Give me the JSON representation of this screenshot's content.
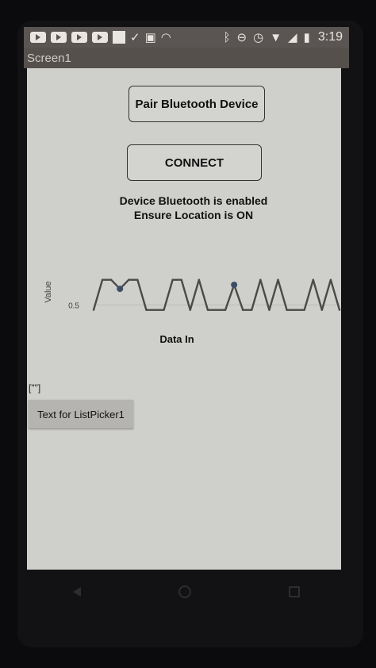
{
  "status_bar": {
    "time": "3:19",
    "icons": [
      "youtube-icon",
      "youtube-icon",
      "youtube-icon",
      "youtube-icon",
      "image-icon",
      "check-icon",
      "photo-icon",
      "cloud-icon",
      "bluetooth-icon",
      "do-not-disturb-icon",
      "alarm-icon",
      "wifi-icon",
      "signal-icon",
      "battery-icon"
    ]
  },
  "app": {
    "title": "Screen1"
  },
  "buttons": {
    "pair_label": "Pair Bluetooth Device",
    "connect_label": "CONNECT"
  },
  "status_lines": [
    "Device Bluetooth is enabled",
    "Ensure Location is ON"
  ],
  "chart_data": {
    "type": "line",
    "xlabel": "Data In",
    "ylabel": "Value",
    "y_ticks": [
      "0.5"
    ],
    "ylim": [
      0,
      1.2
    ],
    "x": [
      0,
      1,
      2,
      3,
      4,
      5,
      6,
      7,
      8,
      9,
      10,
      11,
      12,
      13,
      14,
      15,
      16,
      17,
      18,
      19,
      20,
      21,
      22,
      23,
      24,
      25,
      26,
      27,
      28
    ],
    "values": [
      0.4,
      1.0,
      1.0,
      0.82,
      1.0,
      1.0,
      0.4,
      0.4,
      0.4,
      1.0,
      1.0,
      0.4,
      1.0,
      0.4,
      0.4,
      0.4,
      0.9,
      0.4,
      0.4,
      1.0,
      0.4,
      1.0,
      0.4,
      0.4,
      0.4,
      1.0,
      0.4,
      1.0,
      0.4
    ],
    "markers": [
      3,
      16
    ],
    "line_color": "#4a4a4a",
    "marker_color": "#3d4d66"
  },
  "list_label": "[\"\"]",
  "list_picker_label": "Text for ListPicker1",
  "nav": [
    "back-icon",
    "home-icon",
    "recents-icon"
  ]
}
